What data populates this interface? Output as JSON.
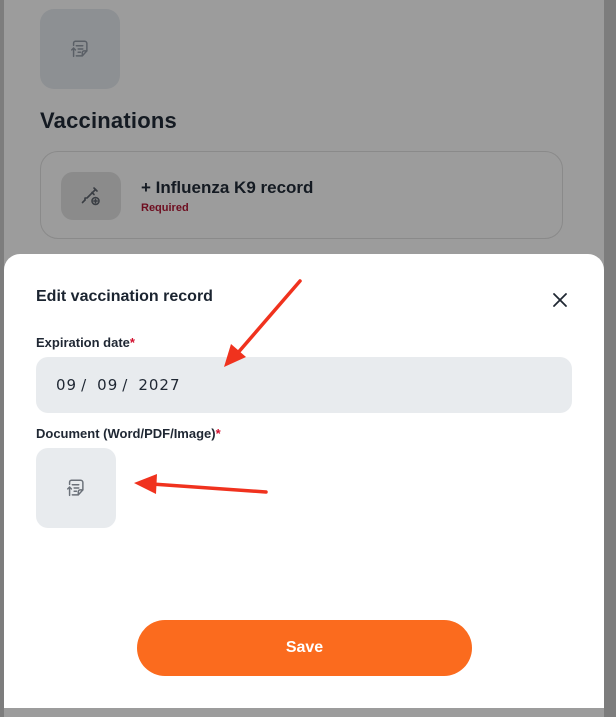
{
  "background": {
    "section_heading": "Vaccinations",
    "record_card": {
      "title": "+ Influenza K9 record",
      "status": "Required"
    }
  },
  "modal": {
    "title": "Edit vaccination record",
    "close_icon": "close-icon",
    "expiration_field": {
      "label": "Expiration date",
      "required_mark": "*",
      "month": "09",
      "day": "09",
      "year": "2027",
      "separator": "/"
    },
    "document_field": {
      "label": "Document (Word/PDF/Image)",
      "required_mark": "*",
      "icon": "document-upload-icon"
    },
    "save_label": "Save"
  },
  "colors": {
    "accent": "#fb6b1e",
    "required": "#d2102e",
    "annotation_arrow": "#f0321e"
  }
}
